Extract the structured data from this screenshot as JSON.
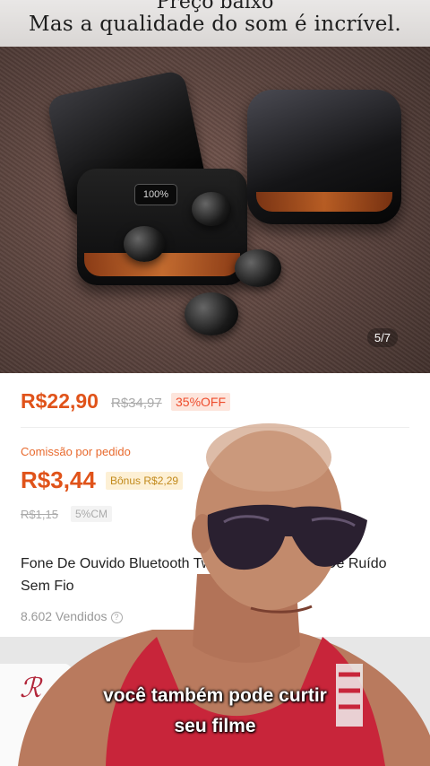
{
  "hero": {
    "caption_line1": "Preço baixo",
    "caption_line2": "Mas a qualidade do som é incrível.",
    "case_display": "100%",
    "image_counter": "5/7"
  },
  "product": {
    "price": "R$22,90",
    "original_price": "R$34,97",
    "discount": "35%OFF",
    "commission_label": "Comissão por pedido",
    "commission_value": "R$3,44",
    "bonus": "Bônus R$2,29",
    "commission_old": "R$1,15",
    "commission_rate": "5%CM",
    "title": "Fone De Ouvido Bluetooth Tws Touch Redução De Ruído Sem Fio",
    "sold": "8.602 Vendidos"
  },
  "video_overlay": {
    "subtitle_line1": "você também pode curtir",
    "subtitle_line2": "seu filme"
  },
  "colors": {
    "price_orange": "#e0531a",
    "discount_red": "#ee4d2d",
    "bonus_gold": "#c28a1c",
    "tank_top_red": "#c8253a"
  }
}
